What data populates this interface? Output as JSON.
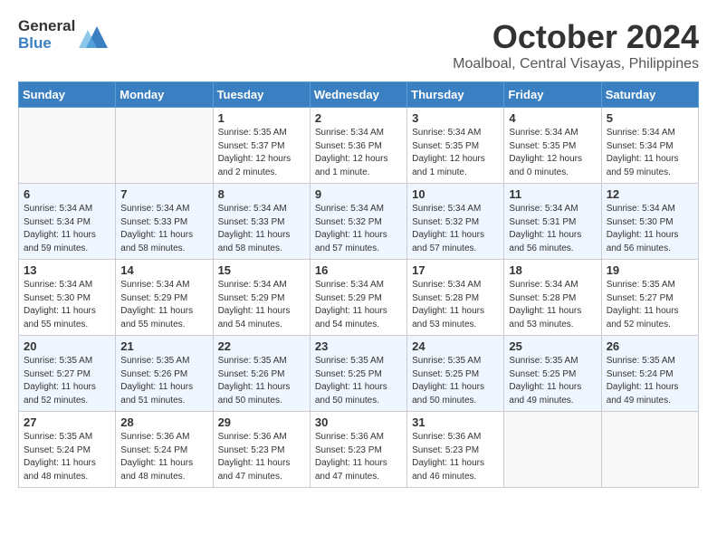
{
  "header": {
    "logo_general": "General",
    "logo_blue": "Blue",
    "month": "October 2024",
    "location": "Moalboal, Central Visayas, Philippines"
  },
  "days_of_week": [
    "Sunday",
    "Monday",
    "Tuesday",
    "Wednesday",
    "Thursday",
    "Friday",
    "Saturday"
  ],
  "weeks": [
    [
      {
        "day": "",
        "sunrise": "",
        "sunset": "",
        "daylight": ""
      },
      {
        "day": "",
        "sunrise": "",
        "sunset": "",
        "daylight": ""
      },
      {
        "day": "1",
        "sunrise": "Sunrise: 5:35 AM",
        "sunset": "Sunset: 5:37 PM",
        "daylight": "Daylight: 12 hours and 2 minutes."
      },
      {
        "day": "2",
        "sunrise": "Sunrise: 5:34 AM",
        "sunset": "Sunset: 5:36 PM",
        "daylight": "Daylight: 12 hours and 1 minute."
      },
      {
        "day": "3",
        "sunrise": "Sunrise: 5:34 AM",
        "sunset": "Sunset: 5:35 PM",
        "daylight": "Daylight: 12 hours and 1 minute."
      },
      {
        "day": "4",
        "sunrise": "Sunrise: 5:34 AM",
        "sunset": "Sunset: 5:35 PM",
        "daylight": "Daylight: 12 hours and 0 minutes."
      },
      {
        "day": "5",
        "sunrise": "Sunrise: 5:34 AM",
        "sunset": "Sunset: 5:34 PM",
        "daylight": "Daylight: 11 hours and 59 minutes."
      }
    ],
    [
      {
        "day": "6",
        "sunrise": "Sunrise: 5:34 AM",
        "sunset": "Sunset: 5:34 PM",
        "daylight": "Daylight: 11 hours and 59 minutes."
      },
      {
        "day": "7",
        "sunrise": "Sunrise: 5:34 AM",
        "sunset": "Sunset: 5:33 PM",
        "daylight": "Daylight: 11 hours and 58 minutes."
      },
      {
        "day": "8",
        "sunrise": "Sunrise: 5:34 AM",
        "sunset": "Sunset: 5:33 PM",
        "daylight": "Daylight: 11 hours and 58 minutes."
      },
      {
        "day": "9",
        "sunrise": "Sunrise: 5:34 AM",
        "sunset": "Sunset: 5:32 PM",
        "daylight": "Daylight: 11 hours and 57 minutes."
      },
      {
        "day": "10",
        "sunrise": "Sunrise: 5:34 AM",
        "sunset": "Sunset: 5:32 PM",
        "daylight": "Daylight: 11 hours and 57 minutes."
      },
      {
        "day": "11",
        "sunrise": "Sunrise: 5:34 AM",
        "sunset": "Sunset: 5:31 PM",
        "daylight": "Daylight: 11 hours and 56 minutes."
      },
      {
        "day": "12",
        "sunrise": "Sunrise: 5:34 AM",
        "sunset": "Sunset: 5:30 PM",
        "daylight": "Daylight: 11 hours and 56 minutes."
      }
    ],
    [
      {
        "day": "13",
        "sunrise": "Sunrise: 5:34 AM",
        "sunset": "Sunset: 5:30 PM",
        "daylight": "Daylight: 11 hours and 55 minutes."
      },
      {
        "day": "14",
        "sunrise": "Sunrise: 5:34 AM",
        "sunset": "Sunset: 5:29 PM",
        "daylight": "Daylight: 11 hours and 55 minutes."
      },
      {
        "day": "15",
        "sunrise": "Sunrise: 5:34 AM",
        "sunset": "Sunset: 5:29 PM",
        "daylight": "Daylight: 11 hours and 54 minutes."
      },
      {
        "day": "16",
        "sunrise": "Sunrise: 5:34 AM",
        "sunset": "Sunset: 5:29 PM",
        "daylight": "Daylight: 11 hours and 54 minutes."
      },
      {
        "day": "17",
        "sunrise": "Sunrise: 5:34 AM",
        "sunset": "Sunset: 5:28 PM",
        "daylight": "Daylight: 11 hours and 53 minutes."
      },
      {
        "day": "18",
        "sunrise": "Sunrise: 5:34 AM",
        "sunset": "Sunset: 5:28 PM",
        "daylight": "Daylight: 11 hours and 53 minutes."
      },
      {
        "day": "19",
        "sunrise": "Sunrise: 5:35 AM",
        "sunset": "Sunset: 5:27 PM",
        "daylight": "Daylight: 11 hours and 52 minutes."
      }
    ],
    [
      {
        "day": "20",
        "sunrise": "Sunrise: 5:35 AM",
        "sunset": "Sunset: 5:27 PM",
        "daylight": "Daylight: 11 hours and 52 minutes."
      },
      {
        "day": "21",
        "sunrise": "Sunrise: 5:35 AM",
        "sunset": "Sunset: 5:26 PM",
        "daylight": "Daylight: 11 hours and 51 minutes."
      },
      {
        "day": "22",
        "sunrise": "Sunrise: 5:35 AM",
        "sunset": "Sunset: 5:26 PM",
        "daylight": "Daylight: 11 hours and 50 minutes."
      },
      {
        "day": "23",
        "sunrise": "Sunrise: 5:35 AM",
        "sunset": "Sunset: 5:25 PM",
        "daylight": "Daylight: 11 hours and 50 minutes."
      },
      {
        "day": "24",
        "sunrise": "Sunrise: 5:35 AM",
        "sunset": "Sunset: 5:25 PM",
        "daylight": "Daylight: 11 hours and 50 minutes."
      },
      {
        "day": "25",
        "sunrise": "Sunrise: 5:35 AM",
        "sunset": "Sunset: 5:25 PM",
        "daylight": "Daylight: 11 hours and 49 minutes."
      },
      {
        "day": "26",
        "sunrise": "Sunrise: 5:35 AM",
        "sunset": "Sunset: 5:24 PM",
        "daylight": "Daylight: 11 hours and 49 minutes."
      }
    ],
    [
      {
        "day": "27",
        "sunrise": "Sunrise: 5:35 AM",
        "sunset": "Sunset: 5:24 PM",
        "daylight": "Daylight: 11 hours and 48 minutes."
      },
      {
        "day": "28",
        "sunrise": "Sunrise: 5:36 AM",
        "sunset": "Sunset: 5:24 PM",
        "daylight": "Daylight: 11 hours and 48 minutes."
      },
      {
        "day": "29",
        "sunrise": "Sunrise: 5:36 AM",
        "sunset": "Sunset: 5:23 PM",
        "daylight": "Daylight: 11 hours and 47 minutes."
      },
      {
        "day": "30",
        "sunrise": "Sunrise: 5:36 AM",
        "sunset": "Sunset: 5:23 PM",
        "daylight": "Daylight: 11 hours and 47 minutes."
      },
      {
        "day": "31",
        "sunrise": "Sunrise: 5:36 AM",
        "sunset": "Sunset: 5:23 PM",
        "daylight": "Daylight: 11 hours and 46 minutes."
      },
      {
        "day": "",
        "sunrise": "",
        "sunset": "",
        "daylight": ""
      },
      {
        "day": "",
        "sunrise": "",
        "sunset": "",
        "daylight": ""
      }
    ]
  ]
}
